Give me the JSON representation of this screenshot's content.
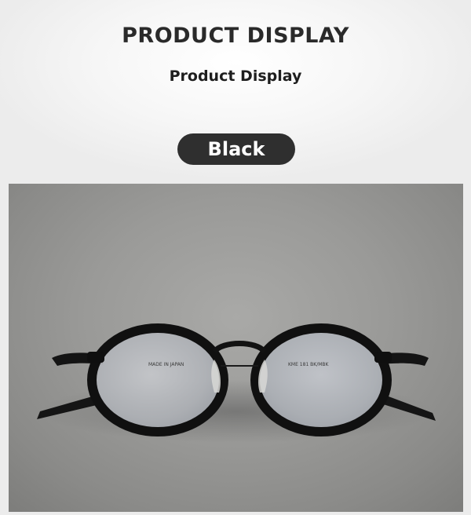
{
  "header": {
    "title": "PRODUCT DISPLAY",
    "subtitle": "Product Display"
  },
  "variant": {
    "color_label": "Black"
  },
  "product_image": {
    "left_lens_print": "MADE IN JAPAN",
    "right_lens_print": "KME 181  BK/MBK"
  },
  "colors": {
    "pill_background": "#2f2f2f",
    "frame": "#111111"
  }
}
